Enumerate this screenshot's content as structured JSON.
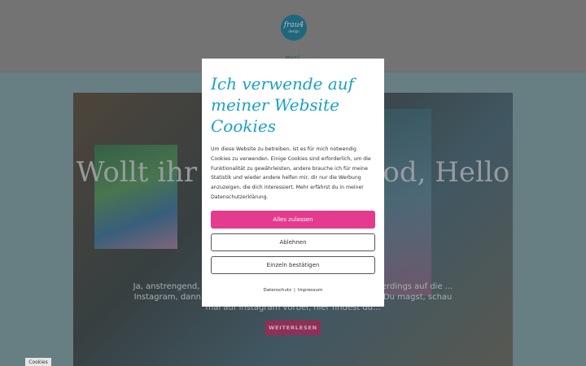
{
  "header": {
    "logo_main": "frau4",
    "logo_sub": "design",
    "nav_link": "Menü"
  },
  "hero": {
    "title": "Wollt ihr fast Paar: good, Hello",
    "text": "Ja, anstrengend, heute fängt es endlich an. Wenn ich jetzt allerdings auf die ... Instagram, dann fängt es kreativ, vielfältig und schön: Wenn Du magst, schau mal auf Instagram vorbei, hier findest du...",
    "button": "WEITERLESEN"
  },
  "modal": {
    "title": "Ich verwende auf meiner Website Cookies",
    "text": "Um diese Website zu betreiben, ist es für mich notwendig Cookies zu verwenden. Einige Cookies sind erforderlich, um die Funktionalität zu gewährleisten, andere brauche ich für meine Statistik und wieder andere helfen mir, dir nur die Werbung anzuzeigen, die dich interessiert. Mehr erfährst du in meiner Datenschutzerklärung.",
    "accept_all": "Alles zulassen",
    "reject": "Ablehnen",
    "confirm_selected": "Einzeln bestätigen",
    "link_privacy": "Datenschutz",
    "link_separator": "|",
    "link_imprint": "Impressum"
  },
  "cookie_tab": "Cookies",
  "colors": {
    "accent": "#1aa1c4",
    "primary_button": "#e43b8e",
    "more_button": "#b8336a"
  }
}
